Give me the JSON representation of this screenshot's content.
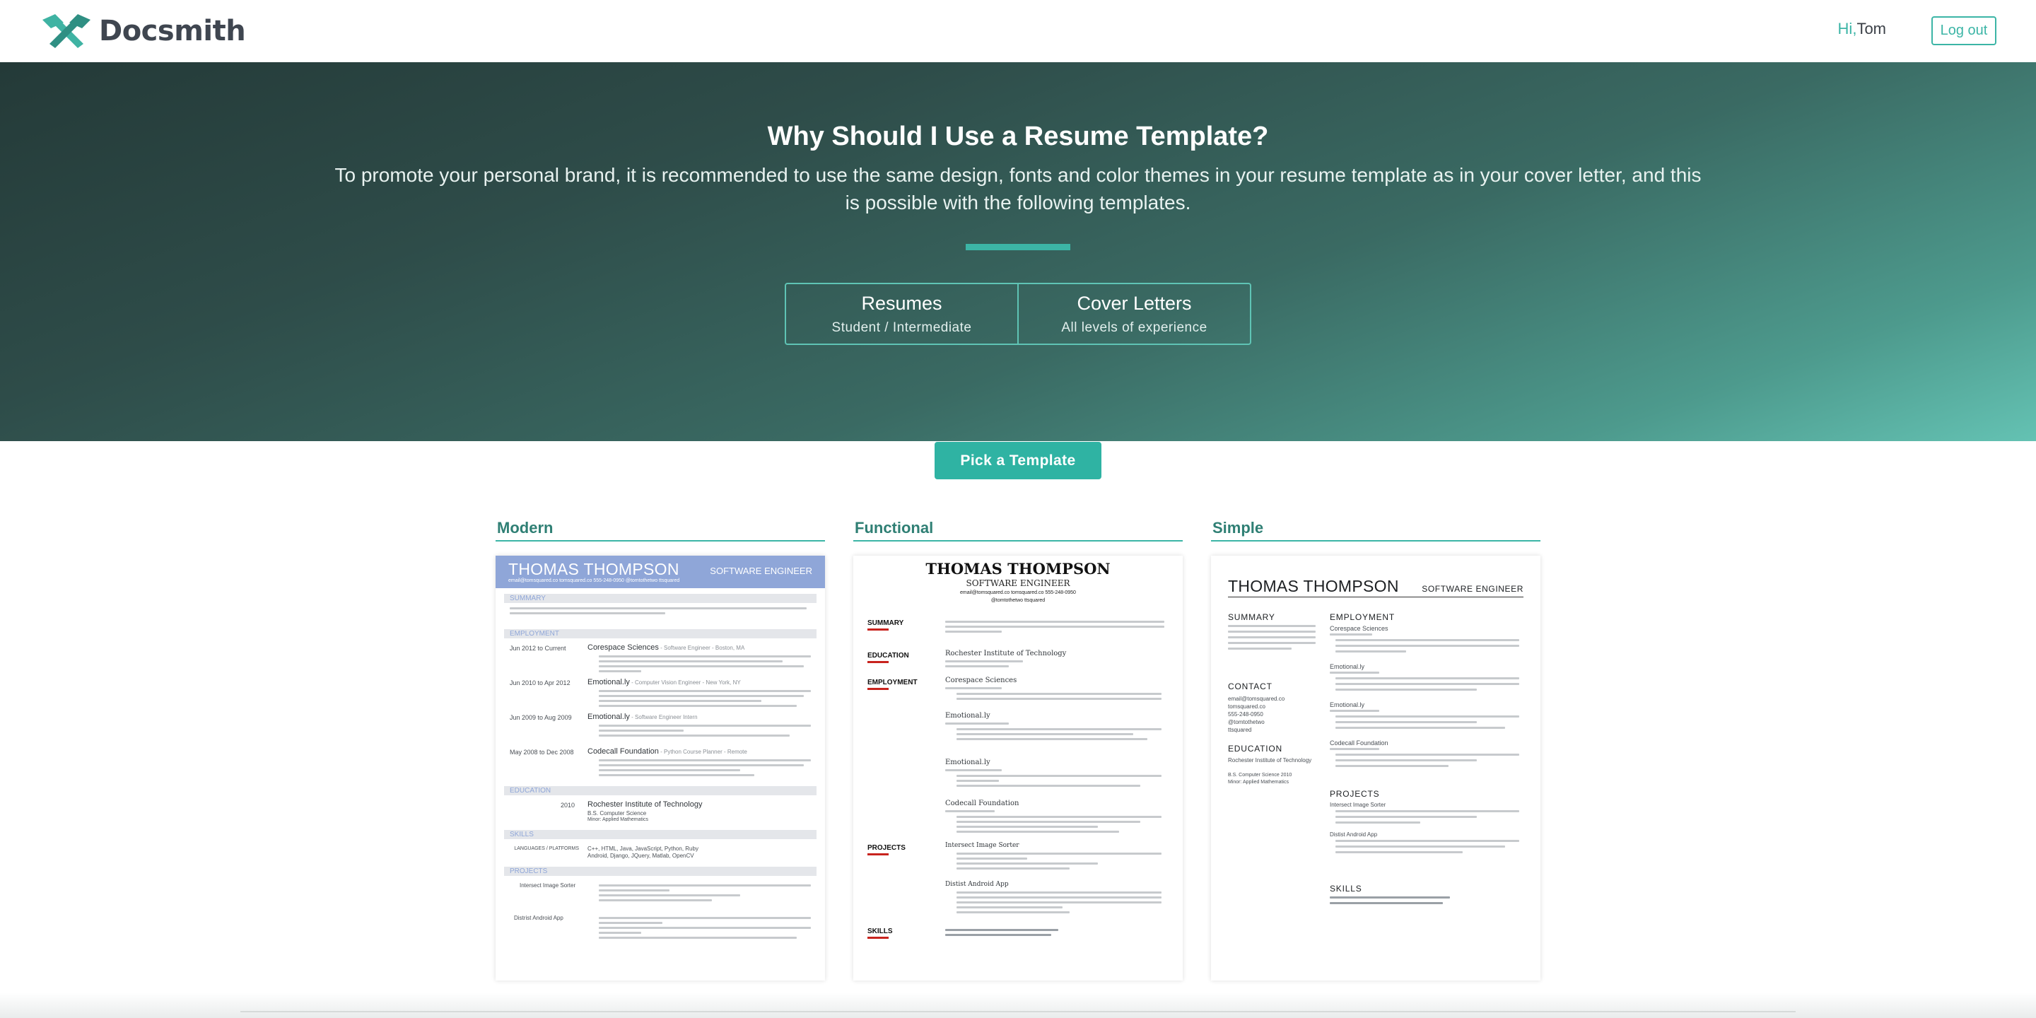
{
  "header": {
    "brand": "Docsmith",
    "greeting_hi": "Hi,",
    "greeting_name": "Tom",
    "logout_label": "Log out"
  },
  "hero": {
    "title": "Why Should I Use a Resume Template?",
    "subtitle": "To promote your personal brand, it is recommended to use the same design, fonts and color themes in your resume template as in your cover letter, and this is possible with the following templates.",
    "tabs": [
      {
        "label": "Resumes",
        "sub": "Student / Intermediate"
      },
      {
        "label": "Cover Letters",
        "sub": "All levels of experience"
      }
    ],
    "cta": "Pick a Template"
  },
  "templates": [
    {
      "label": "Modern",
      "name": "THOMAS THOMPSON",
      "role": "SOFTWARE ENGINEER",
      "contact": "email@tomsquared.co   tomsquared.co   555-248-0950   @tomtothetwo   ttsquared",
      "sections": [
        "SUMMARY",
        "EMPLOYMENT",
        "EDUCATION",
        "SKILLS",
        "PROJECTS"
      ],
      "jobs": [
        {
          "dates": "Jun 2012 to Current",
          "title": "Corespace Sciences",
          "detail": " - Software Engineer - Boston, MA"
        },
        {
          "dates": "Jun 2010 to Apr 2012",
          "title": "Emotional.ly",
          "detail": " - Computer Vision Engineer - New York, NY"
        },
        {
          "dates": "Jun 2009 to Aug 2009",
          "title": "Emotional.ly",
          "detail": " - Software Engineer Intern"
        },
        {
          "dates": "May 2008 to Dec 2008",
          "title": "Codecall Foundation",
          "detail": " - Python Course Planner - Remote"
        }
      ],
      "edu_year": "2010",
      "edu_school": "Rochester Institute of Technology",
      "edu_degree": "B.S. Computer Science",
      "edu_minor": "Minor: Applied Mathematics",
      "skills_label": "LANGUAGES / PLATFORMS",
      "skills_1": "C++, HTML, Java, JavaScript, Python, Ruby",
      "skills_2": "Android, Django, JQuery, Matlab, OpenCV",
      "projects": [
        "Intersect Image Sorter",
        "Distrist Android App"
      ]
    },
    {
      "label": "Functional",
      "name": "THOMAS THOMPSON",
      "role": "SOFTWARE ENGINEER",
      "contact": "email@tomsquared.co   tomsquared.co   555-248-0950",
      "contact2": "@tomtothetwo   ttsquared",
      "sections": [
        "SUMMARY",
        "EDUCATION",
        "EMPLOYMENT",
        "PROJECTS",
        "SKILLS"
      ],
      "edu_school": "Rochester Institute of Technology",
      "jobs": [
        "Corespace Sciences",
        "Emotional.ly",
        "Emotional.ly",
        "Codecall Foundation"
      ],
      "projects": [
        "Intersect Image Sorter",
        "Distist Android App"
      ]
    },
    {
      "label": "Simple",
      "name": "THOMAS THOMPSON",
      "role": "SOFTWARE ENGINEER",
      "left_sections": [
        "SUMMARY",
        "CONTACT",
        "EDUCATION"
      ],
      "right_sections": [
        "EMPLOYMENT",
        "PROJECTS",
        "SKILLS"
      ],
      "contacts": [
        "email@tomsquared.co",
        "tomsquared.co",
        "555-248-0950",
        "@tomtothetwo",
        "ttsquared"
      ],
      "edu_school": "Rochester Institute of Technology",
      "edu_degree": "B.S. Computer Science 2010",
      "edu_minor": "Minor: Applied Mathematics",
      "jobs": [
        "Corespace Sciences",
        "Emotional.ly",
        "Emotional.ly",
        "Codecall Foundation"
      ],
      "projects": [
        "Intersect Image Sorter",
        "Distist Android App"
      ]
    }
  ],
  "colors": {
    "accent": "#3cb5a6",
    "modern_header": "#8fa6d8",
    "functional_bar": "#c8231e"
  }
}
